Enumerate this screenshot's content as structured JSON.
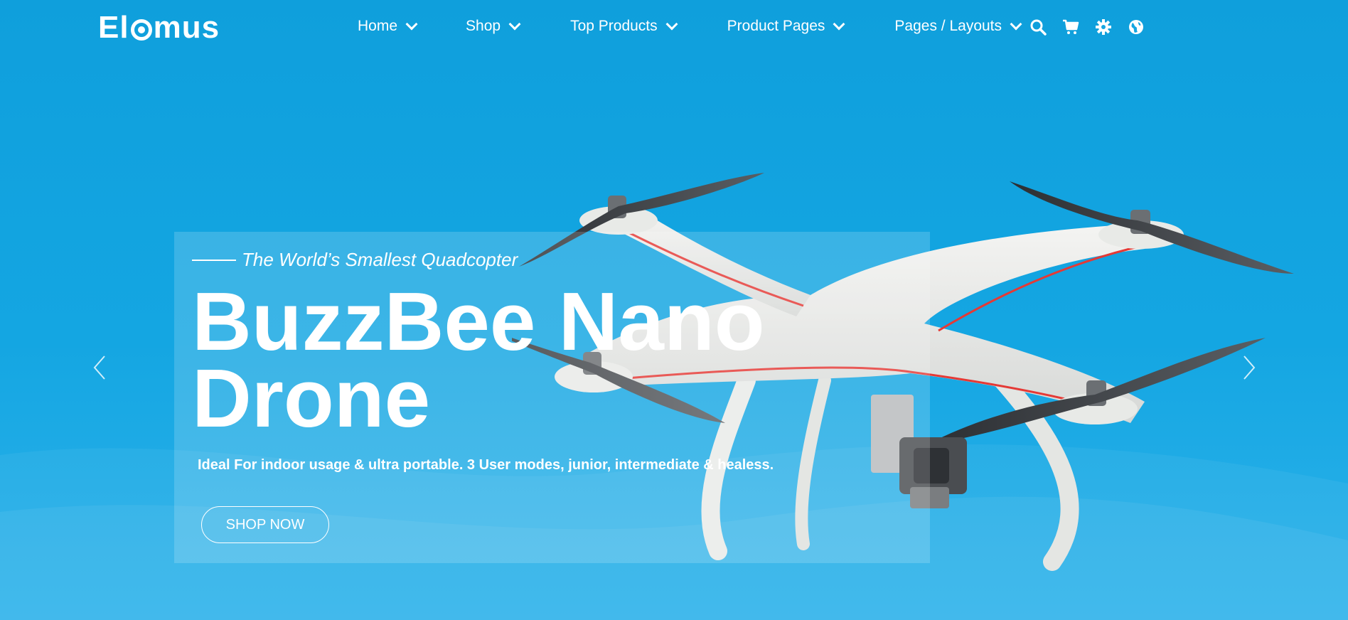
{
  "brand": {
    "logo_text_left": "El",
    "logo_text_right": "mus"
  },
  "nav": {
    "items": [
      {
        "label": "Home"
      },
      {
        "label": "Shop"
      },
      {
        "label": "Top Products"
      },
      {
        "label": "Product Pages"
      },
      {
        "label": "Pages / Layouts"
      }
    ]
  },
  "tools": {
    "icons": [
      "search-icon",
      "cart-icon",
      "gear-icon",
      "globe-icon"
    ]
  },
  "hero": {
    "tagline": "The World’s Smallest Quadcopter",
    "title_line1": "BuzzBee Nano",
    "title_line2": "Drone",
    "description": "Ideal For indoor usage & ultra portable. 3 User modes, junior, intermediate & healess.",
    "button_label": "SHOP NOW"
  },
  "colors": {
    "background": "#14a6e2",
    "accent_red": "#e53935",
    "text": "#ffffff"
  }
}
